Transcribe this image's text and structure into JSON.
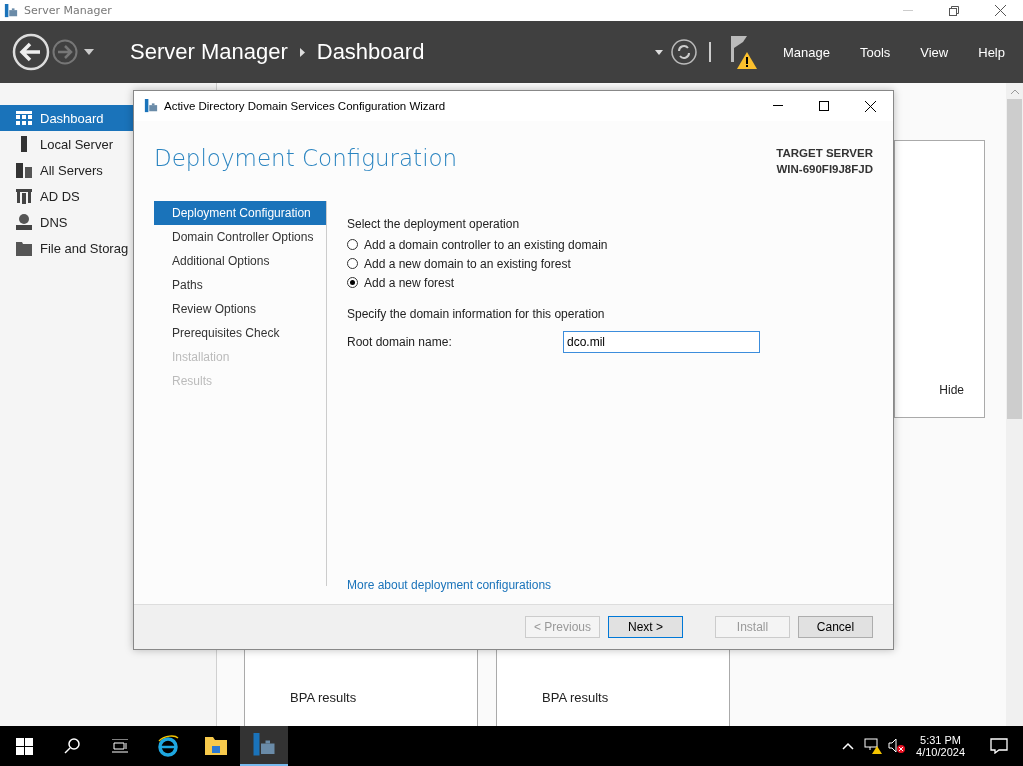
{
  "window": {
    "title": "Server Manager"
  },
  "header": {
    "app": "Server Manager",
    "page": "Dashboard",
    "menu": [
      {
        "label": "Manage"
      },
      {
        "label": "Tools"
      },
      {
        "label": "View"
      },
      {
        "label": "Help"
      }
    ]
  },
  "sidebar": {
    "items": [
      {
        "label": "Dashboard",
        "selected": true
      },
      {
        "label": "Local Server",
        "selected": false
      },
      {
        "label": "All Servers",
        "selected": false
      },
      {
        "label": "AD DS",
        "selected": false
      },
      {
        "label": "DNS",
        "selected": false
      },
      {
        "label": "File and Storag",
        "selected": false
      }
    ]
  },
  "background": {
    "hide_link": "Hide",
    "tiles": [
      {
        "label": "BPA results"
      },
      {
        "label": "BPA results"
      }
    ]
  },
  "dialog": {
    "title": "Active Directory Domain Services Configuration Wizard",
    "heading": "Deployment Configuration",
    "target_label": "TARGET SERVER",
    "target_name": "WIN-690FI9J8FJD",
    "steps": [
      {
        "label": "Deployment Configuration",
        "selected": true,
        "disabled": false
      },
      {
        "label": "Domain Controller Options",
        "selected": false,
        "disabled": false
      },
      {
        "label": "Additional Options",
        "selected": false,
        "disabled": false
      },
      {
        "label": "Paths",
        "selected": false,
        "disabled": false
      },
      {
        "label": "Review Options",
        "selected": false,
        "disabled": false
      },
      {
        "label": "Prerequisites Check",
        "selected": false,
        "disabled": false
      },
      {
        "label": "Installation",
        "selected": false,
        "disabled": true
      },
      {
        "label": "Results",
        "selected": false,
        "disabled": true
      }
    ],
    "operation_prompt": "Select the deployment operation",
    "operations": [
      {
        "label": "Add a domain controller to an existing domain",
        "selected": false
      },
      {
        "label": "Add a new domain to an existing forest",
        "selected": false
      },
      {
        "label": "Add a new forest",
        "selected": true
      }
    ],
    "domain_prompt": "Specify the domain information for this operation",
    "root_domain": {
      "label": "Root domain name:",
      "value": "dco.mil"
    },
    "more_link": "More about deployment configurations",
    "buttons": [
      {
        "label": "< Previous",
        "disabled": true,
        "default": false
      },
      {
        "label": "Next >",
        "disabled": false,
        "default": true
      },
      {
        "label": "Install",
        "disabled": true,
        "default": false
      },
      {
        "label": "Cancel",
        "disabled": false,
        "default": false
      }
    ]
  },
  "taskbar": {
    "time": "5:31 PM",
    "date": "4/10/2024"
  }
}
